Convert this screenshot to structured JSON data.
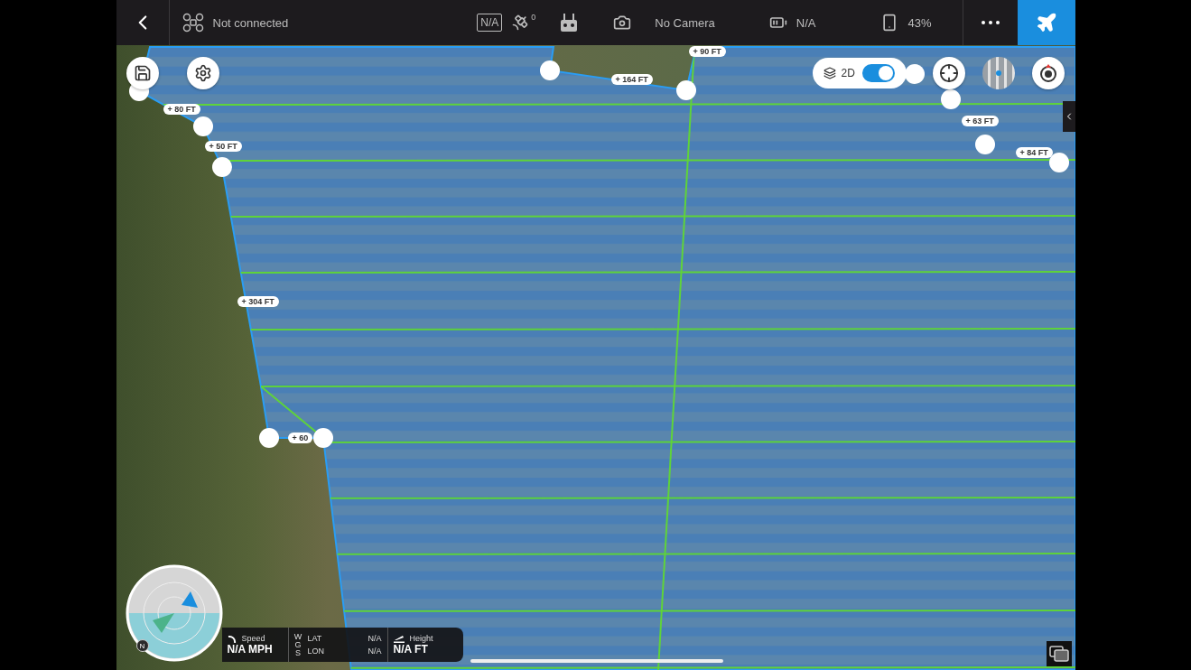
{
  "top_bar": {
    "connection": "Not connected",
    "signal_badge": "N/A",
    "satellite_count": "0",
    "camera": "No Camera",
    "aircraft_battery": "N/A",
    "device_battery": "43%"
  },
  "map_layer": {
    "label": "2D",
    "on": true
  },
  "distance_labels": [
    "+ 80 FT",
    "+ 50 FT",
    "+ 164 FT",
    "+ 90 FT",
    "+ 63 FT",
    "+ 84 FT",
    "+ 304 FT",
    "+ 60"
  ],
  "telemetry": {
    "speed_label": "Speed",
    "speed": "N/A MPH",
    "coord_system": "WGS",
    "lat_label": "LAT",
    "lon_label": "LON",
    "lat": "N/A",
    "lon": "N/A",
    "height_label": "Height",
    "height": "N/A FT"
  },
  "compass": {
    "north": "N"
  }
}
